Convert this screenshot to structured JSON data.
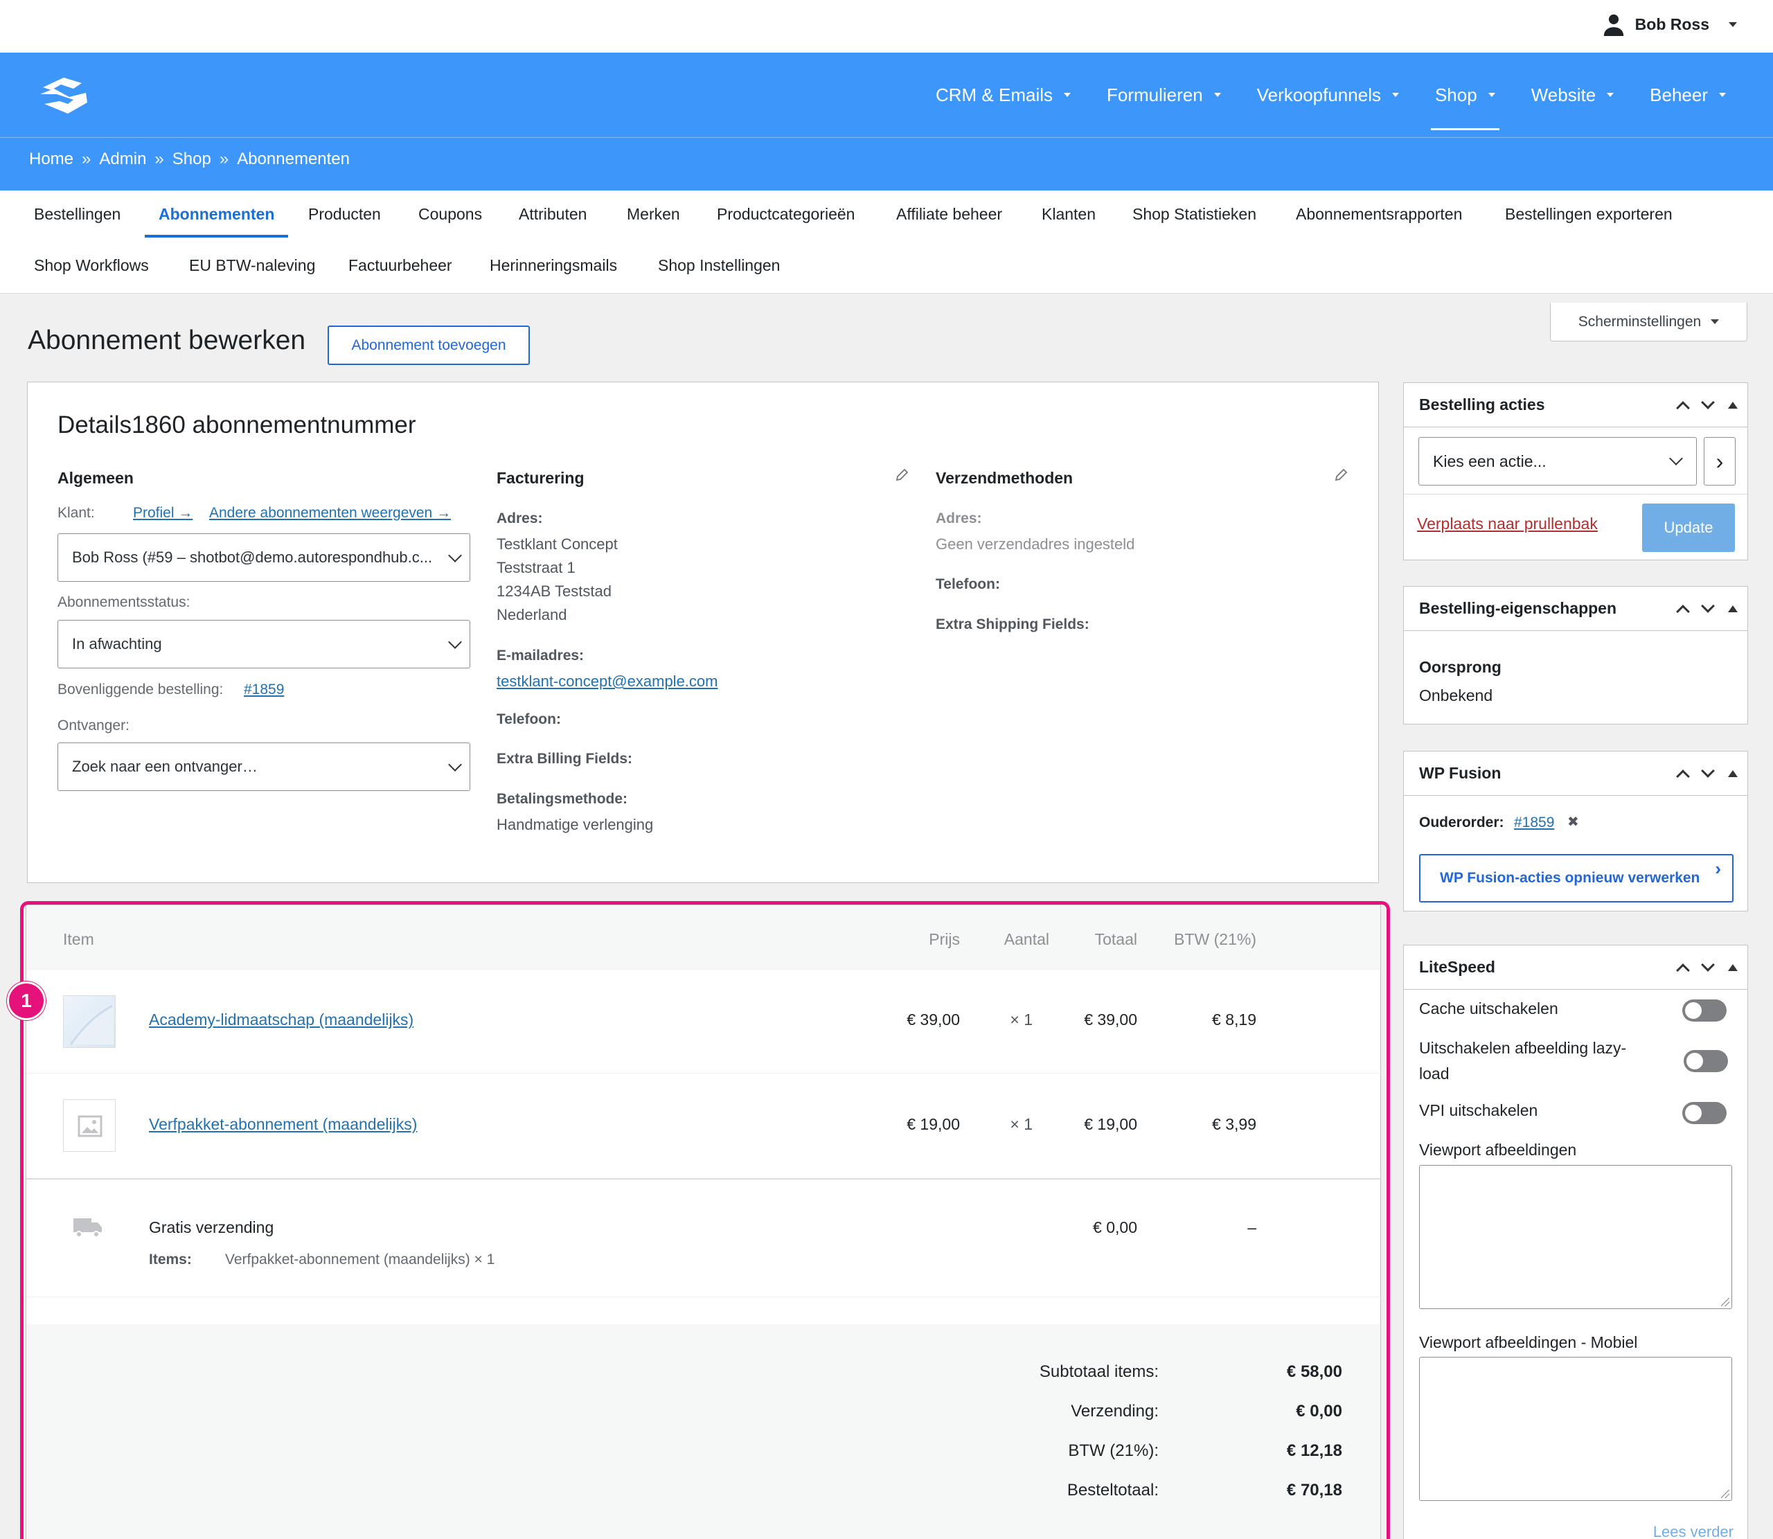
{
  "user": {
    "name": "Bob Ross"
  },
  "nav": {
    "items": [
      "CRM & Emails",
      "Formulieren",
      "Verkoopfunnels",
      "Shop",
      "Website",
      "Beheer"
    ],
    "active": "Shop"
  },
  "breadcrumb": [
    "Home",
    "Admin",
    "Shop",
    "Abonnementen"
  ],
  "breadcrumb_sep": "»",
  "subnav": {
    "row1": [
      "Bestellingen",
      "Abonnementen",
      "Producten",
      "Coupons",
      "Attributen",
      "Merken",
      "Productcategorieën",
      "Affiliate beheer",
      "Klanten",
      "Shop Statistieken",
      "Abonnementsrapporten",
      "Bestellingen exporteren"
    ],
    "row2": [
      "Shop Workflows",
      "EU BTW-naleving",
      "Factuurbeheer",
      "Herinneringsmails",
      "Shop Instellingen"
    ],
    "active": "Abonnementen"
  },
  "page": {
    "title": "Abonnement bewerken",
    "add_button": "Abonnement toevoegen",
    "screen_settings": "Scherminstellingen"
  },
  "details": {
    "title": "Details1860 abonnementnummer",
    "general": {
      "heading": "Algemeen",
      "customer_label": "Klant:",
      "profile_link": "Profiel →",
      "other_subs_link": "Andere abonnementen weergeven →",
      "customer_value": "Bob Ross (#59 – shotbot@demo.autorespondhub.c...",
      "status_label": "Abonnementsstatus:",
      "status_value": "In afwachting",
      "parent_label": "Bovenliggende bestelling:",
      "parent_link": "#1859",
      "recipient_label": "Ontvanger:",
      "recipient_placeholder": "Zoek naar een ontvanger…"
    },
    "billing": {
      "heading": "Facturering",
      "address_label": "Adres:",
      "address_lines": [
        "Testklant Concept",
        "Teststraat 1",
        "1234AB Teststad",
        "Nederland"
      ],
      "email_label": "E-mailadres:",
      "email": "testklant-concept@example.com",
      "phone_label": "Telefoon:",
      "extra_label": "Extra Billing Fields:",
      "payment_label": "Betalingsmethode:",
      "payment_value": "Handmatige verlenging"
    },
    "shipping": {
      "heading": "Verzendmethoden",
      "address_label": "Adres:",
      "address_value": "Geen verzendadres ingesteld",
      "phone_label": "Telefoon:",
      "extra_label": "Extra Shipping Fields:"
    }
  },
  "items": {
    "headers": {
      "item": "Item",
      "price": "Prijs",
      "qty": "Aantal",
      "total": "Totaal",
      "tax": "BTW (21%)"
    },
    "rows": [
      {
        "name": "Academy-lidmaatschap (maandelijks)",
        "price": "€ 39,00",
        "qty": "× 1",
        "total": "€ 39,00",
        "tax": "€ 8,19"
      },
      {
        "name": "Verfpakket-abonnement (maandelijks)",
        "price": "€ 19,00",
        "qty": "× 1",
        "total": "€ 19,00",
        "tax": "€ 3,99"
      }
    ],
    "shipping": {
      "name": "Gratis verzending",
      "items_label": "Items:",
      "items_value": "Verfpakket-abonnement (maandelijks) × 1",
      "total": "€ 0,00",
      "tax": "–"
    },
    "totals": [
      {
        "label": "Subtotaal items:",
        "value": "€ 58,00"
      },
      {
        "label": "Verzending:",
        "value": "€ 0,00"
      },
      {
        "label": "BTW (21%):",
        "value": "€ 12,18"
      },
      {
        "label": "Besteltotaal:",
        "value": "€ 70,18"
      }
    ],
    "badge": "1"
  },
  "sidebar": {
    "order_actions": {
      "title": "Bestelling acties",
      "select": "Kies een actie...",
      "go": "›",
      "trash": "Verplaats naar prullenbak",
      "update": "Update"
    },
    "order_props": {
      "title": "Bestelling-eigenschappen",
      "origin_label": "Oorsprong",
      "origin_value": "Onbekend"
    },
    "wp_fusion": {
      "title": "WP Fusion",
      "parent_label": "Ouderorder:",
      "parent_link": "#1859",
      "remove": "✖",
      "button": "WP Fusion-acties opnieuw verwerken",
      "button_icon": "›"
    },
    "litespeed": {
      "title": "LiteSpeed",
      "cache": "Cache uitschakelen",
      "lazy": "Uitschakelen afbeelding lazy-load",
      "vpi": "VPI uitschakelen",
      "viewport": "Viewport afbeeldingen",
      "viewport_mobile": "Viewport afbeeldingen - Mobiel",
      "read_more": "Lees verder"
    }
  },
  "colors": {
    "brand": "#3d96fa",
    "highlight": "#e4127a",
    "link": "#2271b1",
    "update_btn": "#72aee6",
    "trash": "#b32d2e"
  }
}
